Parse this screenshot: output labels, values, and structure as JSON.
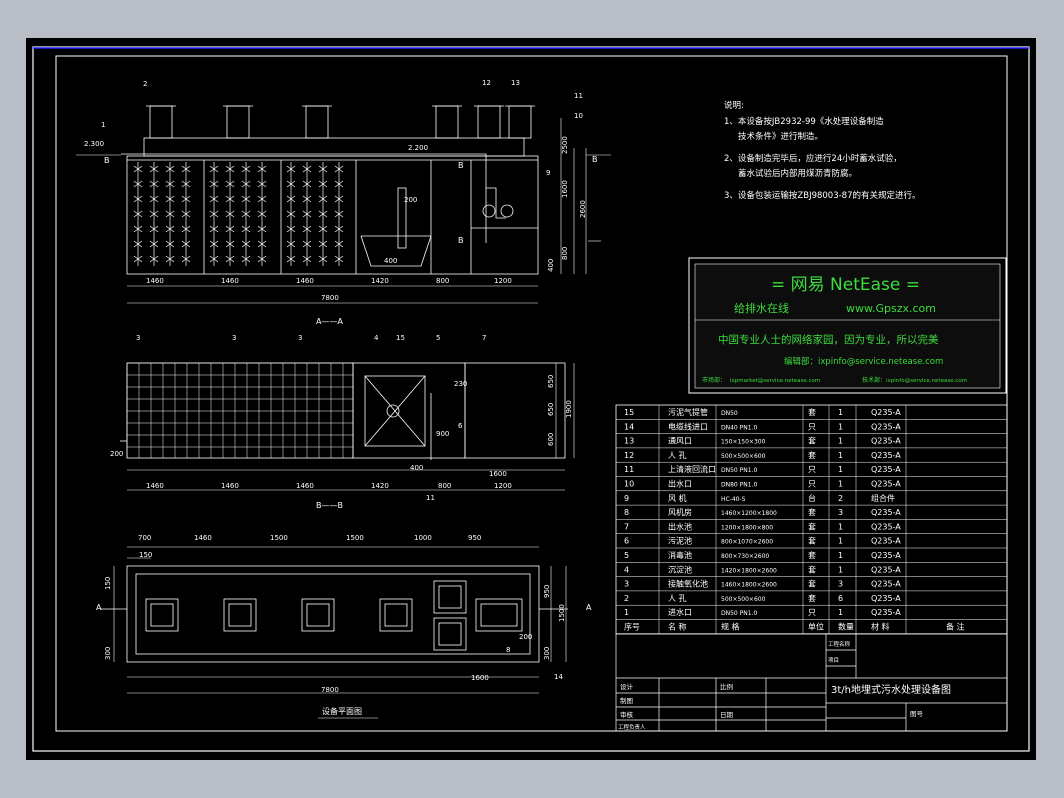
{
  "colors": {
    "background": "#000000",
    "frame": "#ffffff",
    "panel_border": "#ffffff",
    "netease_green": "#3cdc3c",
    "netease_inner_bg": "#0d0d0d",
    "accent_blue": "#1a1aff"
  },
  "notes": {
    "title": "说明:",
    "items": [
      "1、本设备按JB2932-99《水处理设备制造",
      "技术条件》进行制造。",
      "2、设备制造完毕后，应进行24小时蓄水试验，",
      "蓄水试验后内部用煤沥青防腐。",
      "3、设备包装运输按ZBJ98003-87的有关规定进行。"
    ]
  },
  "netease": {
    "heading": "=  网易 NetEase  =",
    "subtitle": "给排水在线",
    "url": "www.Gpszx.com",
    "slogan": "中国专业人士的网络家园，因为专业，所以完美",
    "editor": "编辑部：ixpinfo@service.netease.com",
    "market_label": "市场部：",
    "market_email": "ixpmarket@service.netease.com",
    "tech_label": "技术部：",
    "tech_email": "ixpinfo@service.netease.com"
  },
  "section_aa": {
    "label": "A——A",
    "dims": [
      "1460",
      "1460",
      "1460",
      "1420",
      "800",
      "1200"
    ],
    "total": "7800",
    "callouts": [
      "1",
      "2",
      "12",
      "13",
      "9",
      "10",
      "11"
    ],
    "level_left": "2.300",
    "level_mid": "2.200",
    "heights": [
      "2500",
      "2600",
      "1600",
      "400",
      "800",
      "200"
    ],
    "inner_dims": [
      "200",
      "400"
    ],
    "cut_b": "B"
  },
  "section_bb": {
    "label": "B——B",
    "dims": [
      "1460",
      "1460",
      "1460",
      "1420",
      "800",
      "1200"
    ],
    "sub_dims": [
      "400",
      "1600"
    ],
    "heights": [
      "650",
      "650",
      "600",
      "1900"
    ],
    "inner_dims": [
      "230",
      "900"
    ],
    "left_dim": "200",
    "callouts": [
      "3",
      "3",
      "3",
      "4",
      "15",
      "5",
      "7",
      "6",
      "11"
    ]
  },
  "plan": {
    "label": "设备平面图",
    "top_dims": [
      "700",
      "1460",
      "1500",
      "1500",
      "1000",
      "950"
    ],
    "left_dims": [
      "150",
      "150",
      "300"
    ],
    "right_dims": [
      "950",
      "1500",
      "200",
      "300"
    ],
    "bottom_dims": [
      "1600",
      "7800"
    ],
    "callouts": [
      "8",
      "14"
    ],
    "cut_a": "A"
  },
  "parts_table": {
    "rows": [
      [
        "15",
        "污泥气提管",
        "DN50",
        "套",
        "1",
        "Q235-A"
      ],
      [
        "14",
        "电缆线进口",
        "DN40 PN1.0",
        "只",
        "1",
        "Q235-A"
      ],
      [
        "13",
        "通风口",
        "150×150×300",
        "套",
        "1",
        "Q235-A"
      ],
      [
        "12",
        "人  孔",
        "500×500×600",
        "套",
        "1",
        "Q235-A"
      ],
      [
        "11",
        "上清液回流口",
        "DN50 PN1.0",
        "只",
        "1",
        "Q235-A"
      ],
      [
        "10",
        "出水口",
        "DN80 PN1.0",
        "只",
        "1",
        "Q235-A"
      ],
      [
        "9",
        "风  机",
        "HC-40-S",
        "台",
        "2",
        "组合件"
      ],
      [
        "8",
        "风机房",
        "1460×1200×1800",
        "套",
        "3",
        "Q235-A"
      ],
      [
        "7",
        "出水池",
        "1200×1800×800",
        "套",
        "1",
        "Q235-A"
      ],
      [
        "6",
        "污泥池",
        "800×1070×2600",
        "套",
        "1",
        "Q235-A"
      ],
      [
        "5",
        "消毒池",
        "800×730×2600",
        "套",
        "1",
        "Q235-A"
      ],
      [
        "4",
        "沉淀池",
        "1420×1800×2600",
        "套",
        "1",
        "Q235-A"
      ],
      [
        "3",
        "接触氧化池",
        "1460×1800×2600",
        "套",
        "3",
        "Q235-A"
      ],
      [
        "2",
        "人  孔",
        "500×500×600",
        "套",
        "6",
        "Q235-A"
      ],
      [
        "1",
        "进水口",
        "DN50  PN1.0",
        "只",
        "1",
        "Q235-A"
      ]
    ],
    "header": [
      "序号",
      "名  称",
      "规  格",
      "单位",
      "数量",
      "材  料",
      "备  注"
    ]
  },
  "title_block": {
    "drawing_title": "3t/h地埋式污水处理设备图",
    "labels": [
      "设计",
      "制图",
      "审核",
      "工程负责人",
      "比例",
      "日期",
      "图号",
      "工程名称",
      "项目"
    ]
  }
}
